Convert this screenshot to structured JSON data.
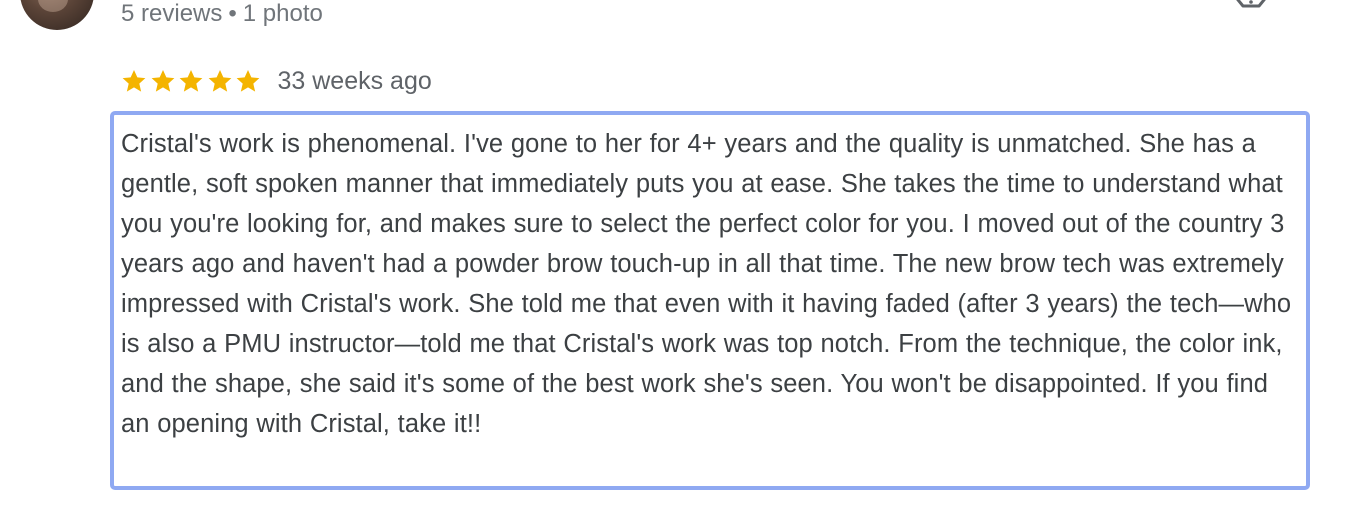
{
  "reviewer": {
    "meta_reviews": "5 reviews",
    "meta_separator": "•",
    "meta_photos": "1 photo"
  },
  "review": {
    "rating": 5,
    "rating_max": 5,
    "star_color": "#f4b400",
    "time_ago": "33 weeks ago",
    "text": "Cristal's work is phenomenal. I've gone to her for 4+ years and the quality is unmatched. She has a gentle, soft spoken manner that immediately puts you at ease. She takes the time to understand what you you're looking for, and makes sure to select the perfect color for you. I moved out of the country 3 years ago and haven't had a powder brow touch-up in all that time. The new brow tech was extremely impressed with Cristal's work. She told me that even with it having faded (after 3 years) the tech—who is also a PMU instructor—told me that Cristal's work was top notch. From the technique, the color ink, and the shape, she said it's some of the best work she's seen. You won't be disappointed. If you find an opening with Cristal, take it!!"
  },
  "icons": {
    "avatar": "reviewer-avatar",
    "flag": "report-flag-icon",
    "star": "star-icon"
  },
  "colors": {
    "selection_border": "#8fa9f2",
    "meta_text": "#70757a"
  }
}
